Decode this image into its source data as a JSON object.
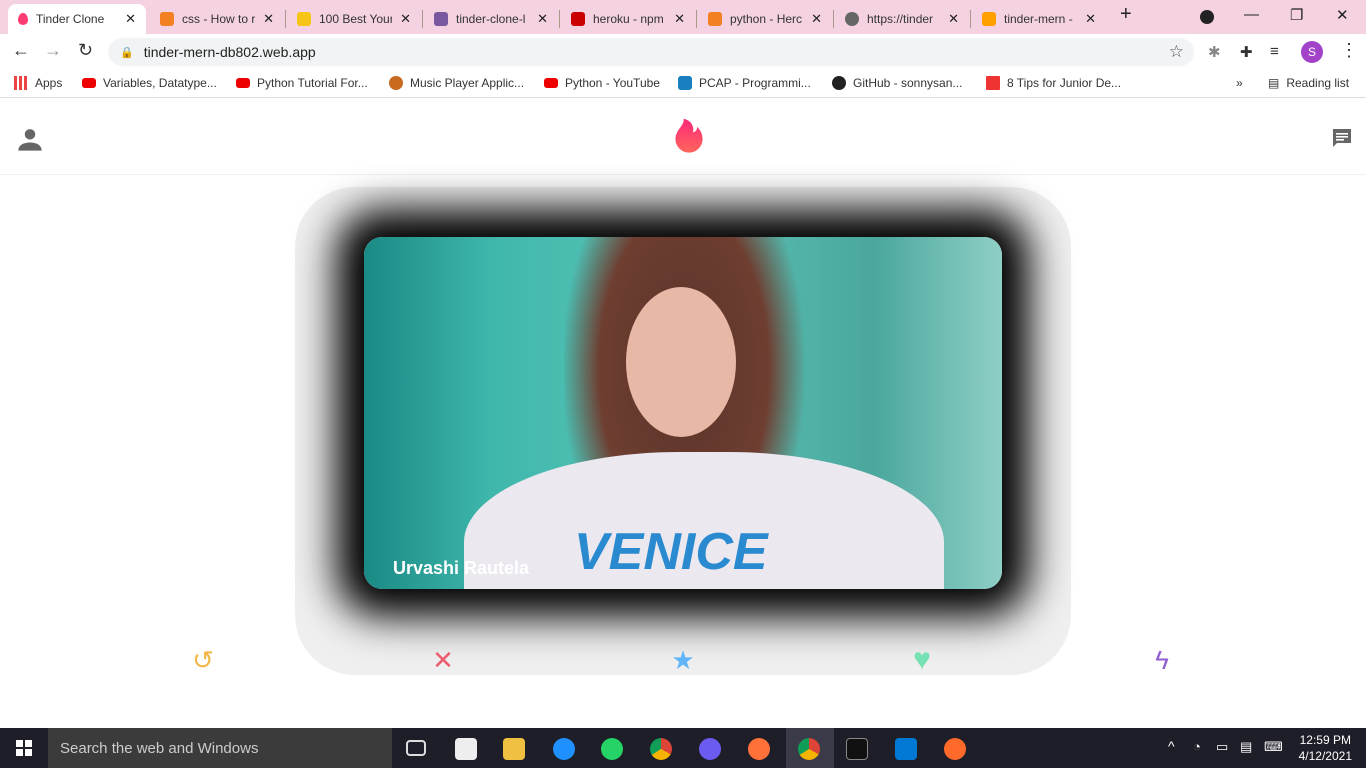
{
  "browser": {
    "tabs": [
      {
        "title": "Tinder Clone",
        "color": "#fe3c72"
      },
      {
        "title": "css - How to r",
        "color": "#f48024"
      },
      {
        "title": "100 Best Your",
        "color": "#f5c518"
      },
      {
        "title": "tinder-clone-l",
        "color": "#79589f"
      },
      {
        "title": "heroku - npm",
        "color": "#cb0000"
      },
      {
        "title": "python - Herc",
        "color": "#f48024"
      },
      {
        "title": "https://tinder",
        "color": "#666666"
      },
      {
        "title": "tinder-mern -",
        "color": "#ffa000"
      }
    ],
    "new_tab": "+",
    "url": "tinder-mern-db802.web.app",
    "profile_initial": "S",
    "bookmarks": [
      "Apps",
      "Variables, Datatype...",
      "Python Tutorial For...",
      "Music Player Applic...",
      "Python - YouTube",
      "PCAP - Programmi...",
      "GitHub - sonnysan...",
      "8 Tips for Junior De..."
    ],
    "more_bookmarks": "»",
    "reading_list": "Reading list"
  },
  "app": {
    "card": {
      "name": "Urvashi Rautela",
      "shirt_text": "VENICE"
    },
    "colors": {
      "replay": "#f5b748",
      "close": "#ec5e6f",
      "star": "#62b4f9",
      "heart": "#76e2b3",
      "bolt": "#915dd1",
      "brand": "#fe3c72"
    }
  },
  "taskbar": {
    "search_placeholder": "Search the web and Windows",
    "time": "12:59 PM",
    "date": "4/12/2021"
  }
}
